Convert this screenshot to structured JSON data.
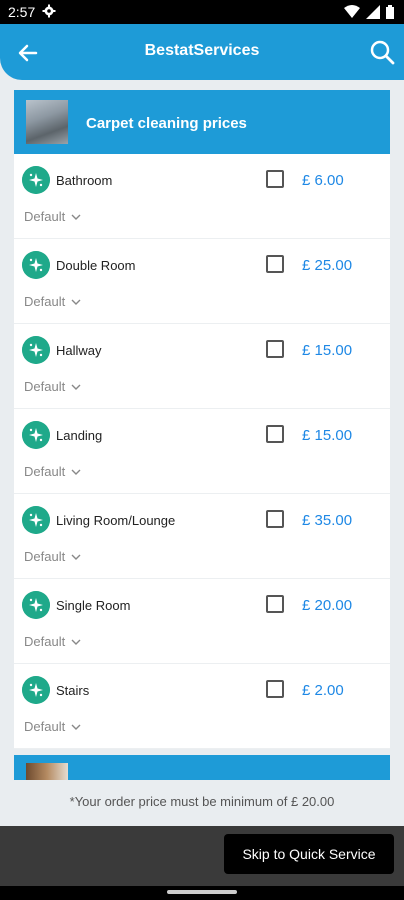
{
  "status_bar": {
    "time": "2:57"
  },
  "app_bar": {
    "title": "BestatServices"
  },
  "category": {
    "title": "Carpet cleaning prices"
  },
  "items": [
    {
      "name": "Bathroom",
      "price": "£ 6.00",
      "option": "Default"
    },
    {
      "name": "Double Room",
      "price": "£ 25.00",
      "option": "Default"
    },
    {
      "name": "Hallway",
      "price": "£ 15.00",
      "option": "Default"
    },
    {
      "name": "Landing",
      "price": "£ 15.00",
      "option": "Default"
    },
    {
      "name": "Living Room/Lounge",
      "price": "£ 35.00",
      "option": "Default"
    },
    {
      "name": "Single Room",
      "price": "£ 20.00",
      "option": "Default"
    },
    {
      "name": "Stairs",
      "price": "£ 2.00",
      "option": "Default"
    }
  ],
  "footer": {
    "min_note": "*Your order price must be minimum of £ 20.00",
    "skip_label": "Skip to Quick Service"
  },
  "colors": {
    "primary": "#1e9bd7",
    "icon_bg": "#1fa98a",
    "price": "#1e88e5"
  }
}
